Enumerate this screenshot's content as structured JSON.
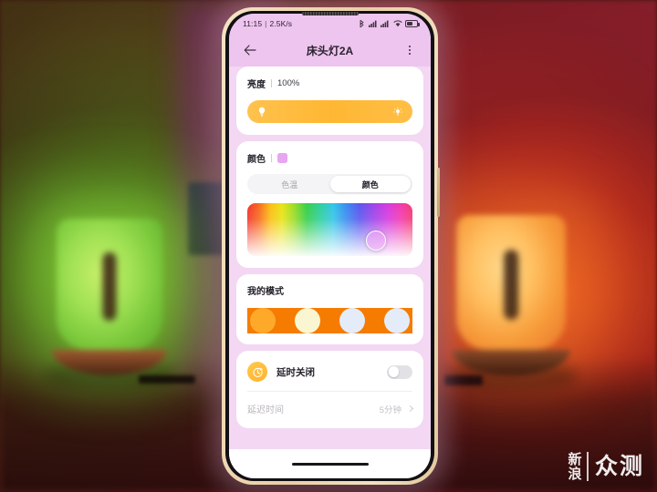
{
  "background": {
    "description": "Blurred photo of two glowing bedside lamps",
    "left_lamp_color": "#8ed93c",
    "right_lamp_color": "#f79b3a",
    "wall_color": "#7d1f26"
  },
  "watermark": {
    "brand": "新浪",
    "product": "众测"
  },
  "phone": {
    "frame_color": "#efd9b4",
    "statusbar": {
      "time": "11:15",
      "separator": "|",
      "network_speed": "2.5K/s",
      "icons": [
        "bluetooth-icon",
        "signal-icon",
        "signal-icon",
        "wifi-icon",
        "battery-icon"
      ]
    },
    "appbar": {
      "back_label": "返回",
      "title": "床头灯2A",
      "menu_label": "更多"
    }
  },
  "brightness": {
    "label": "亮度",
    "separator": "|",
    "value": "100%",
    "percent": 100,
    "track_color": "#ffb733",
    "left_icon": "bulb-icon",
    "right_icon": "bulb-bright-icon"
  },
  "color": {
    "label": "颜色",
    "swatch_hex": "#e6a6f0",
    "tabs": [
      {
        "label": "色温",
        "active": false
      },
      {
        "label": "颜色",
        "active": true
      }
    ],
    "picker": {
      "knob_x_percent": 78,
      "knob_y_percent": 70,
      "selected_hex": "#f0aaf6"
    }
  },
  "modes": {
    "title": "我的模式",
    "presets": [
      {
        "name": "preset-deep-orange",
        "hex": "#f57c00"
      },
      {
        "name": "preset-amber",
        "hex": "#ffa92b"
      },
      {
        "name": "preset-warm-cream",
        "hex": "#fbf6d2"
      },
      {
        "name": "preset-cool-white",
        "hex": "#e4ecfa"
      }
    ]
  },
  "timer": {
    "icon": "timer-icon",
    "label": "延时关闭",
    "enabled": false,
    "delay_label": "延迟时间",
    "delay_value": "5分钟"
  },
  "nav": {
    "home_indicator": "home-indicator"
  }
}
